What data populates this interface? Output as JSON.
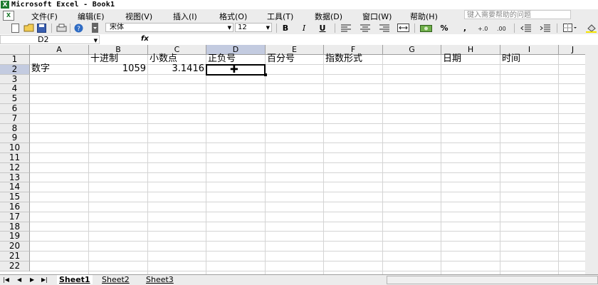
{
  "window": {
    "title": "Microsoft Excel - Book1",
    "app_icon_letter": "X"
  },
  "menu": {
    "items": [
      "文件(F)",
      "编辑(E)",
      "视图(V)",
      "插入(I)",
      "格式(O)",
      "工具(T)",
      "数据(D)",
      "窗口(W)",
      "帮助(H)"
    ],
    "help_placeholder": "键入需要帮助的问题"
  },
  "toolbar": {
    "font_name": "宋体",
    "font_size": "12",
    "bold_label": "B",
    "italic_label": "I",
    "underline_label": "U",
    "percent_label": "%",
    "comma_label": ","
  },
  "formula_bar": {
    "name_box": "D2",
    "fx_label": "fx",
    "content": ""
  },
  "sheet": {
    "columns": [
      "A",
      "B",
      "C",
      "D",
      "E",
      "F",
      "G",
      "H",
      "I",
      "J"
    ],
    "selected_column": "D",
    "rows": [
      "1",
      "2",
      "3",
      "4",
      "5",
      "6",
      "7",
      "8",
      "9",
      "10",
      "11",
      "12",
      "13",
      "14",
      "15",
      "16",
      "17",
      "18",
      "19",
      "20",
      "21",
      "22"
    ],
    "selected_row": "2",
    "cells": {
      "B1": "十进制",
      "C1": "小数点",
      "D1": "正负号",
      "E1": "百分号",
      "F1": "指数形式",
      "H1": "日期",
      "I1": "时间",
      "A2": "数字",
      "B2": "1059",
      "C2": "3.1416"
    },
    "active_cell": "D2"
  },
  "tabs": {
    "items": [
      "Sheet1",
      "Sheet2",
      "Sheet3"
    ],
    "active": "Sheet1"
  }
}
